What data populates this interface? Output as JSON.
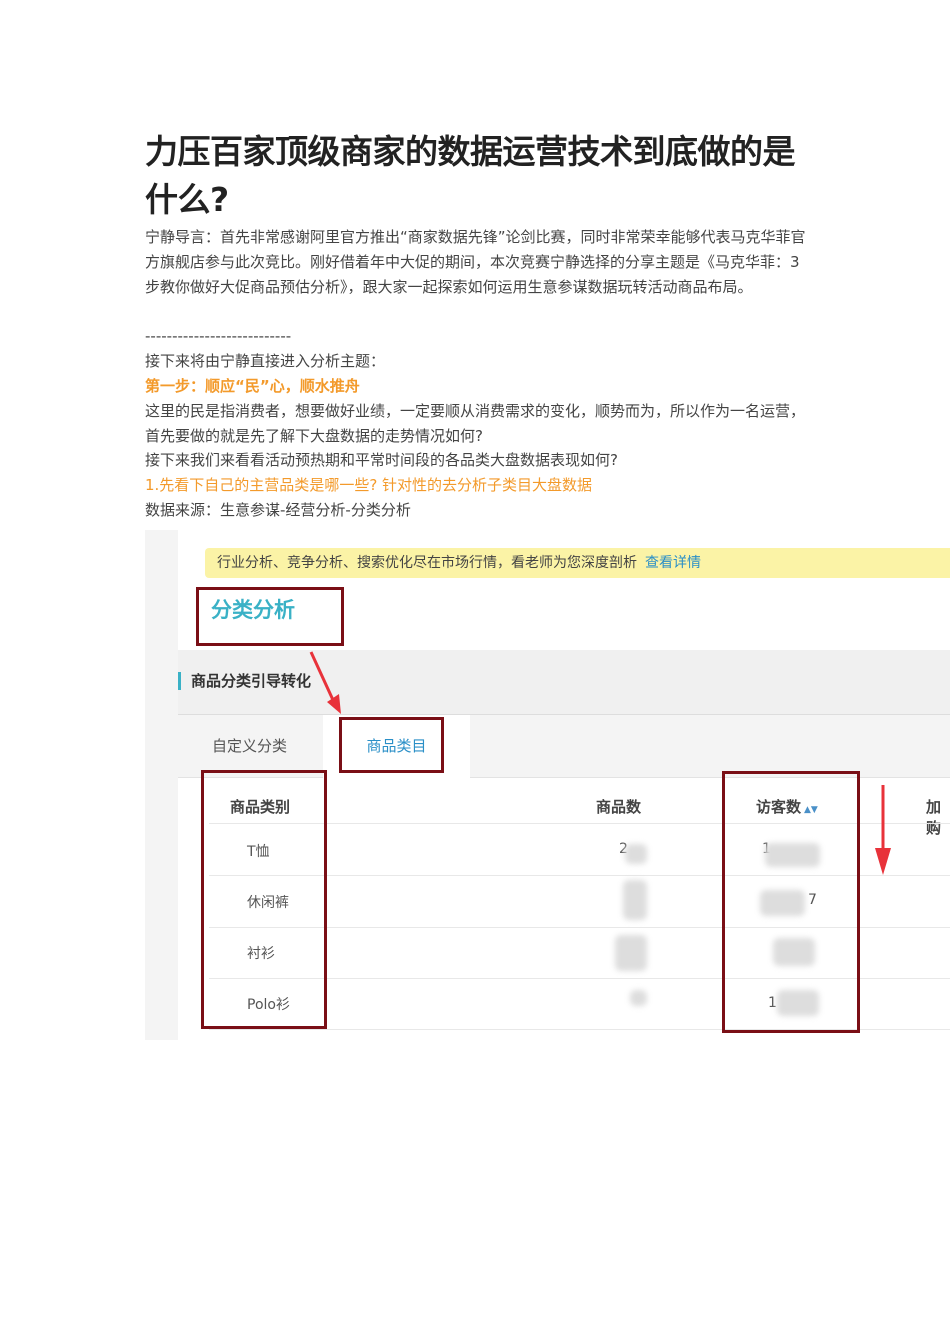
{
  "article": {
    "title": "力压百家顶级商家的数据运营技术到底做的是什么?",
    "intro": "宁静导言：首先非常感谢阿里官方推出“商家数据先锋”论剑比赛，同时非常荣幸能够代表马克华菲官方旗舰店参与此次竞比。刚好借着年中大促的期间，本次竞赛宁静选择的分享主题是《马克华菲：3 步教你做好大促商品预估分析》，跟大家一起探索如何运用生意参谋数据玩转活动商品布局。",
    "divider": "---------------------------",
    "lead": "接下来将由宁静直接进入分析主题：",
    "step1": "第一步：顺应“民”心，顺水推舟",
    "p1": "这里的民是指消费者，想要做好业绩，一定要顺从消费需求的变化，顺势而为，所以作为一名运营，首先要做的就是先了解下大盘数据的走势情况如何?",
    "p2": "接下来我们来看看活动预热期和平常时间段的各品类大盘数据表现如何?",
    "point1": "1.先看下自己的主营品类是哪一些? 针对性的去分析子类目大盘数据",
    "source": "数据来源：生意参谋-经营分析-分类分析"
  },
  "screenshot": {
    "banner_text": "行业分析、竞争分析、搜索优化尽在市场行情，看老师为您深度剖析",
    "banner_link": "查看详情",
    "page_title": "分类分析",
    "section_title": "商品分类引导转化",
    "tabs": [
      "自定义分类",
      "商品类目"
    ],
    "active_tab": "商品类目",
    "columns": [
      "商品类别",
      "商品数",
      "访客数",
      "加购"
    ],
    "rows": [
      {
        "category": "T恤",
        "count_fragment": "2",
        "visitors_fragment": "1"
      },
      {
        "category": "休闲裤",
        "count_fragment": "",
        "visitors_fragment": "7"
      },
      {
        "category": "衬衫",
        "count_fragment": "",
        "visitors_fragment": ""
      },
      {
        "category": "Polo衫",
        "count_fragment": "",
        "visitors_fragment": "1"
      }
    ],
    "annotation_color": "#7a0f16",
    "arrow_color": "#e8323a"
  }
}
